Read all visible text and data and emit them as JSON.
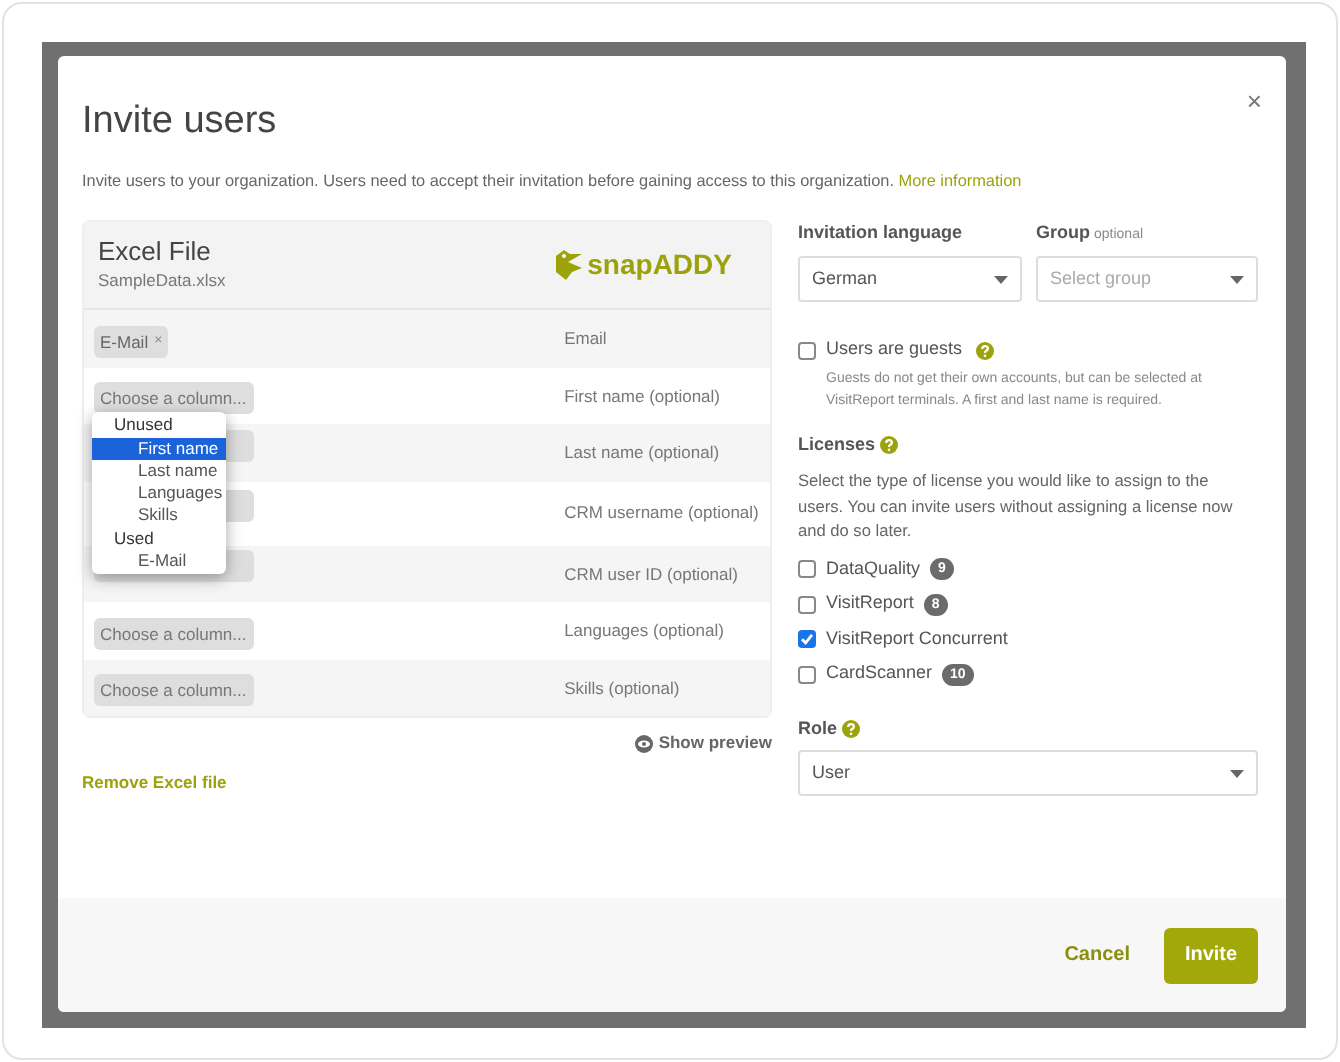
{
  "dialog": {
    "title": "Invite users",
    "close": "×",
    "intro": "Invite users to your organization. Users need to accept their invitation before gaining access to this organization.",
    "intro_link": "More information"
  },
  "excel_file": {
    "title": "Excel File",
    "filename": "SampleData.xlsx",
    "logo_text": "snapADDY",
    "mappings": [
      {
        "kind": "tag",
        "value": "E-Mail",
        "remove": "×",
        "field": "Email"
      },
      {
        "kind": "select",
        "placeholder": "Choose a column...",
        "field": "First name (optional)"
      },
      {
        "kind": "select",
        "field": "Last name (optional)"
      },
      {
        "kind": "select",
        "field": "CRM username (optional)"
      },
      {
        "kind": "select",
        "field": "CRM user ID (optional)"
      },
      {
        "kind": "select",
        "placeholder": "Choose a column...",
        "field": "Languages (optional)"
      },
      {
        "kind": "select",
        "placeholder": "Choose a column...",
        "field": "Skills (optional)"
      }
    ],
    "dropdown": [
      {
        "label": "Unused",
        "options": [
          {
            "label": "First name",
            "selected": true
          },
          {
            "label": "Last name",
            "selected": false
          },
          {
            "label": "Languages",
            "selected": false
          },
          {
            "label": "Skills",
            "selected": false
          }
        ]
      },
      {
        "label": "Used",
        "options": [
          {
            "label": "E-Mail",
            "selected": false
          }
        ]
      }
    ],
    "show_preview": "Show preview",
    "remove": "Remove Excel file"
  },
  "invitation_language": {
    "label": "Invitation language",
    "value": "German"
  },
  "group": {
    "label": "Group",
    "hint": "optional",
    "placeholder": "Select group"
  },
  "guests": {
    "label": "Users are guests",
    "checked": false,
    "help": "Guests do not get their own accounts, but can be selected at VisitReport terminals. A first and last name is required."
  },
  "licenses": {
    "title": "Licenses",
    "description": "Select the type of license you would like to assign to the users. You can invite users without assigning a license now and do so later.",
    "items": [
      {
        "label": "DataQuality",
        "count": "9",
        "checked": false
      },
      {
        "label": "VisitReport",
        "count": "8",
        "checked": false
      },
      {
        "label": "VisitReport Concurrent",
        "checked": true
      },
      {
        "label": "CardScanner",
        "count": "10",
        "checked": false
      }
    ]
  },
  "role": {
    "label": "Role",
    "value": "User"
  },
  "footer": {
    "cancel": "Cancel",
    "submit": "Invite"
  }
}
